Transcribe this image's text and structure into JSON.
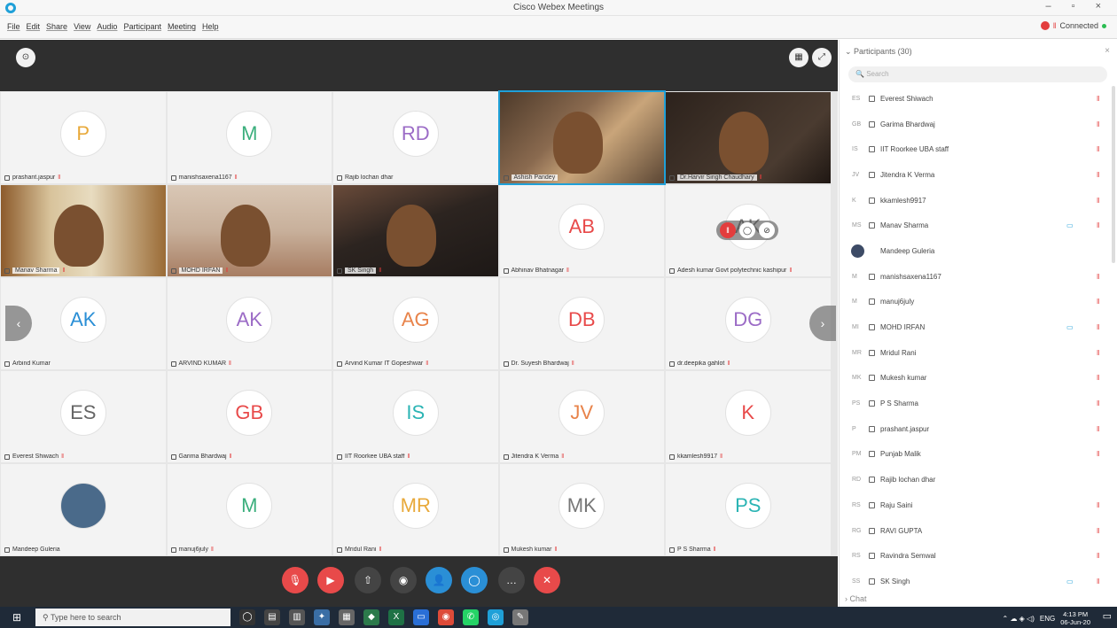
{
  "window": {
    "title": "Cisco Webex Meetings"
  },
  "menu": [
    "File",
    "Edit",
    "Share",
    "View",
    "Audio",
    "Participant",
    "Meeting",
    "Help"
  ],
  "status": {
    "connection": "Connected"
  },
  "grid_tiles": [
    {
      "initials": "P",
      "color": "#e8a93a",
      "name": "prashant.jaspur",
      "mute": true,
      "video": null
    },
    {
      "initials": "M",
      "color": "#3aae7c",
      "name": "manishsaxena1167",
      "mute": true,
      "video": null
    },
    {
      "initials": "RD",
      "color": "#9b6bc6",
      "name": "Rajib lochan dhar",
      "mute": false,
      "video": null
    },
    {
      "initials": "",
      "color": "",
      "name": "Ashish Pandey",
      "mute": false,
      "video": "vid1",
      "active": true
    },
    {
      "initials": "",
      "color": "",
      "name": "Dr.Harvir Singh Chaudhary",
      "mute": true,
      "video": "vid2"
    },
    {
      "initials": "",
      "color": "",
      "name": "Manav Sharma",
      "mute": true,
      "video": "vid3"
    },
    {
      "initials": "",
      "color": "",
      "name": "MOHD IRFAN",
      "mute": true,
      "video": "vid4"
    },
    {
      "initials": "",
      "color": "",
      "name": "SK Singh",
      "mute": true,
      "video": "vid5"
    },
    {
      "initials": "AB",
      "color": "#e84a4a",
      "name": "Abhinav Bhatnagar",
      "mute": true,
      "video": null
    },
    {
      "initials": "AK",
      "color": "#777777",
      "name": "Adesh kumar Govt polytechnic kashipur",
      "mute": true,
      "video": null,
      "hover": true
    },
    {
      "initials": "AK",
      "color": "#2a8fd6",
      "name": "Arbind Kumar",
      "mute": false,
      "video": null
    },
    {
      "initials": "AK",
      "color": "#9b6bc6",
      "name": "ARVIND KUMAR",
      "mute": true,
      "video": null
    },
    {
      "initials": "AG",
      "color": "#e8834a",
      "name": "Arvind Kumar IT Gopeshwar",
      "mute": true,
      "video": null
    },
    {
      "initials": "DB",
      "color": "#e84a4a",
      "name": "Dr. Suyesh Bhardwaj",
      "mute": true,
      "video": null
    },
    {
      "initials": "DG",
      "color": "#9b6bc6",
      "name": "dr.deepika gahlot",
      "mute": true,
      "video": null
    },
    {
      "initials": "ES",
      "color": "#666666",
      "name": "Everest Shiwach",
      "mute": true,
      "video": null
    },
    {
      "initials": "GB",
      "color": "#e84a4a",
      "name": "Garima Bhardwaj",
      "mute": true,
      "video": null
    },
    {
      "initials": "IS",
      "color": "#2bb4b4",
      "name": "IIT Roorkee UBA staff",
      "mute": true,
      "video": null
    },
    {
      "initials": "JV",
      "color": "#e8834a",
      "name": "Jitendra K Verma",
      "mute": true,
      "video": null
    },
    {
      "initials": "K",
      "color": "#e84a4a",
      "name": "kkamlesh9917",
      "mute": true,
      "video": null
    },
    {
      "initials": "",
      "color": "",
      "name": "Mandeep Guleria",
      "mute": false,
      "video": null,
      "photo": true
    },
    {
      "initials": "M",
      "color": "#3aae7c",
      "name": "manuj6july",
      "mute": true,
      "video": null
    },
    {
      "initials": "MR",
      "color": "#e8a93a",
      "name": "Mridul Rani",
      "mute": true,
      "video": null
    },
    {
      "initials": "MK",
      "color": "#777777",
      "name": "Mukesh kumar",
      "mute": true,
      "video": null
    },
    {
      "initials": "PS",
      "color": "#2bb4b4",
      "name": "P S Sharma",
      "mute": true,
      "video": null
    }
  ],
  "controls": [
    "mute",
    "stop-video",
    "share",
    "record",
    "participants",
    "chat",
    "more",
    "leave"
  ],
  "participants": {
    "header": "Participants (30)",
    "search_placeholder": "Search",
    "list": [
      {
        "initials": "ES",
        "name": "Everest Shiwach",
        "mic": true,
        "cam": false
      },
      {
        "initials": "GB",
        "name": "Garima Bhardwaj",
        "mic": true,
        "cam": false
      },
      {
        "initials": "IS",
        "name": "IIT Roorkee UBA staff",
        "mic": true,
        "cam": false
      },
      {
        "initials": "JV",
        "name": "Jitendra K Verma",
        "mic": true,
        "cam": false
      },
      {
        "initials": "K",
        "name": "kkamlesh9917",
        "mic": true,
        "cam": false
      },
      {
        "initials": "MS",
        "name": "Manav Sharma",
        "mic": true,
        "cam": true
      },
      {
        "initials": "",
        "name": "Mandeep Guleria",
        "mic": false,
        "cam": false,
        "photo": true
      },
      {
        "initials": "M",
        "name": "manishsaxena1167",
        "mic": true,
        "cam": false
      },
      {
        "initials": "M",
        "name": "manuj6july",
        "mic": true,
        "cam": false
      },
      {
        "initials": "MI",
        "name": "MOHD IRFAN",
        "mic": true,
        "cam": true
      },
      {
        "initials": "MR",
        "name": "Mridul Rani",
        "mic": true,
        "cam": false
      },
      {
        "initials": "MK",
        "name": "Mukesh kumar",
        "mic": true,
        "cam": false
      },
      {
        "initials": "PS",
        "name": "P S Sharma",
        "mic": true,
        "cam": false
      },
      {
        "initials": "P",
        "name": "prashant.jaspur",
        "mic": true,
        "cam": false
      },
      {
        "initials": "PM",
        "name": "Punjab Malik",
        "mic": true,
        "cam": false
      },
      {
        "initials": "RD",
        "name": "Rajib lochan dhar",
        "mic": false,
        "cam": false
      },
      {
        "initials": "RS",
        "name": "Raju Saini",
        "mic": true,
        "cam": false
      },
      {
        "initials": "RG",
        "name": "RAVI GUPTA",
        "mic": true,
        "cam": false
      },
      {
        "initials": "RS",
        "name": "Ravindra Semwal",
        "mic": true,
        "cam": false
      },
      {
        "initials": "SS",
        "name": "SK Singh",
        "mic": true,
        "cam": true
      }
    ],
    "chat_label": "Chat"
  },
  "taskbar": {
    "search_placeholder": "Type here to search",
    "lang": "ENG",
    "time": "4:13 PM",
    "date": "06-Jun-20"
  }
}
